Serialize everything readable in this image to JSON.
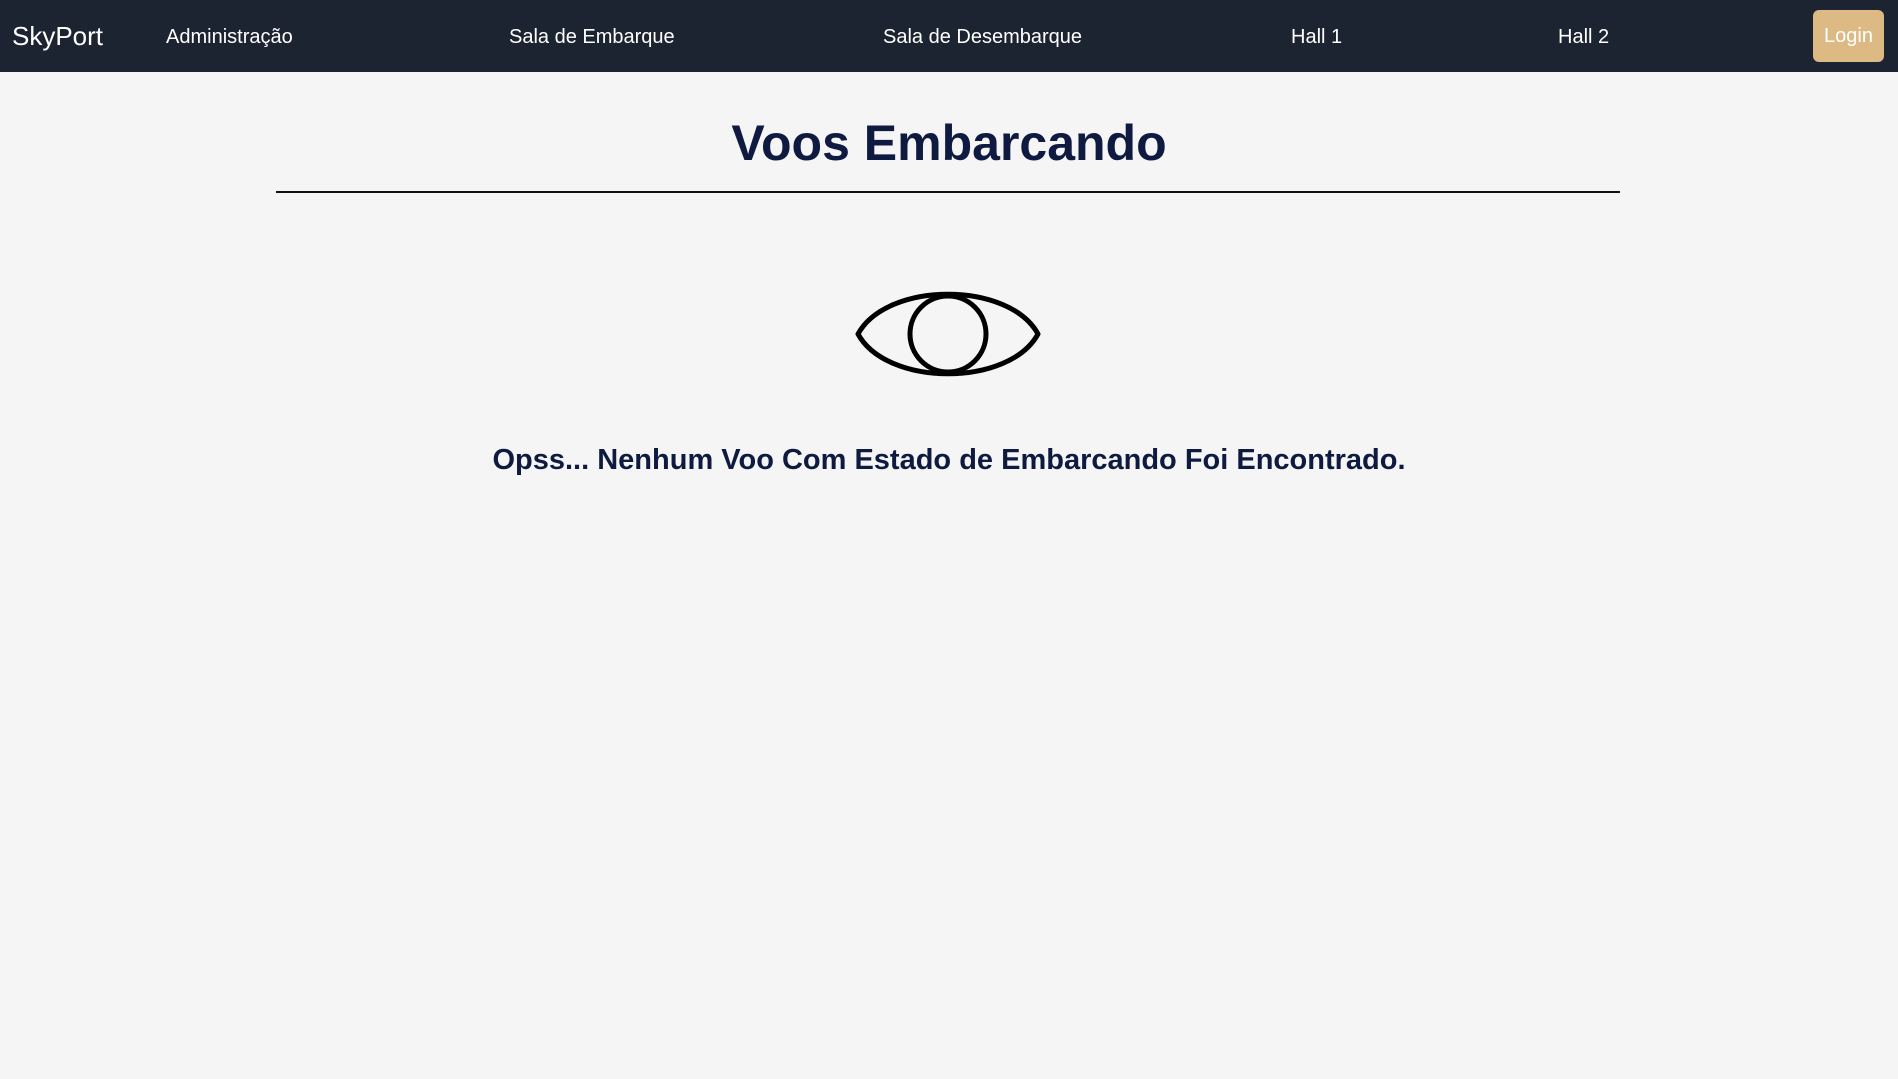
{
  "colors": {
    "navbar_bg": "#1b2430",
    "nav_text": "#ffffff",
    "login_bg": "#ddb984",
    "page_bg": "#f5f5f5",
    "title_text": "#0f1a40",
    "rule": "#111111",
    "icon_stroke": "#000000"
  },
  "navbar": {
    "brand": "SkyPort",
    "links": [
      {
        "label": "Administração"
      },
      {
        "label": "Sala de Embarque"
      },
      {
        "label": "Sala de Desembarque"
      },
      {
        "label": "Hall 1"
      },
      {
        "label": "Hall 2"
      }
    ],
    "login_label": "Login"
  },
  "main": {
    "title": "Voos Embarcando",
    "empty_icon": "eye-icon",
    "empty_message": "Opss... Nenhum Voo Com Estado de Embarcando Foi Encontrado."
  }
}
